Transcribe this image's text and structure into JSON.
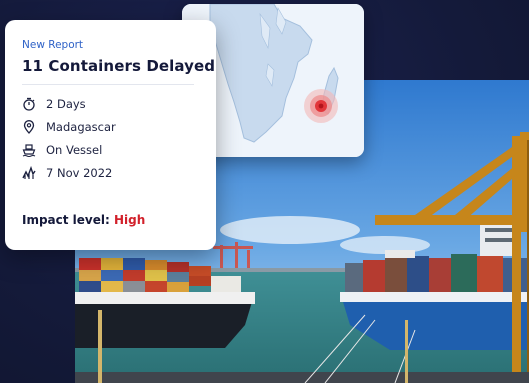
{
  "report": {
    "eyebrow": "New Report",
    "title": "11 Containers Delayed",
    "details": [
      {
        "icon": "stopwatch-icon",
        "text": "2 Days"
      },
      {
        "icon": "location-pin-icon",
        "text": "Madagascar"
      },
      {
        "icon": "ship-icon",
        "text": "On Vessel"
      },
      {
        "icon": "chart-trend-icon",
        "text": "7 Nov 2022"
      }
    ],
    "impact_label": "Impact level:",
    "impact_value": "High"
  },
  "colors": {
    "accent_blue": "#2f62c7",
    "impact_red": "#d2212b",
    "background_navy": "#141a3a"
  }
}
